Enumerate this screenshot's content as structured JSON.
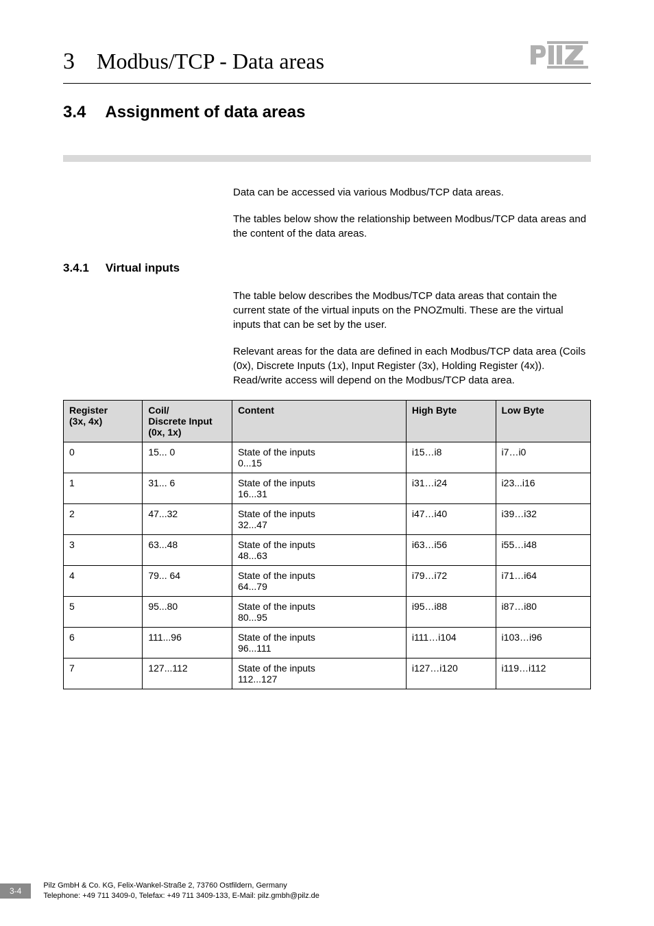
{
  "chapter": {
    "number": "3",
    "title": "Modbus/TCP - Data areas"
  },
  "section": {
    "number": "3.4",
    "title": "Assignment of data areas"
  },
  "intro": {
    "p1": "Data can be accessed via various Modbus/TCP data areas.",
    "p2": "The tables below show the relationship between Modbus/TCP data areas and the content of the data areas."
  },
  "subsection": {
    "number": "3.4.1",
    "title": "Virtual inputs"
  },
  "subintro": {
    "p1": "The table below describes the Modbus/TCP data areas that contain the current state of the virtual inputs on the PNOZmulti. These are the virtual inputs that can be set by the user.",
    "p2": "Relevant areas for the data are defined in each Modbus/TCP data area (Coils (0x), Discrete Inputs (1x), Input Register (3x), Holding Register (4x)). Read/write access will depend on the Modbus/TCP data area."
  },
  "table": {
    "headers": {
      "register": "Register\n(3x, 4x)",
      "coil": "Coil/\nDiscrete Input\n(0x, 1x)",
      "content": "Content",
      "high": "High Byte",
      "low": "Low Byte"
    },
    "rows": [
      {
        "reg": "0",
        "coil": "15... 0",
        "content": "State of the inputs\n0...15",
        "high": "i15…i8",
        "low": "i7…i0"
      },
      {
        "reg": "1",
        "coil": "31... 6",
        "content": "State of the inputs\n16...31",
        "high": "i31…i24",
        "low": "i23...i16"
      },
      {
        "reg": "2",
        "coil": "47...32",
        "content": "State of the inputs\n32...47",
        "high": "i47…i40",
        "low": "i39…i32"
      },
      {
        "reg": "3",
        "coil": "63...48",
        "content": "State of the inputs\n48...63",
        "high": "i63…i56",
        "low": "i55…i48"
      },
      {
        "reg": "4",
        "coil": "79... 64",
        "content": "State of the inputs\n64...79",
        "high": "i79…i72",
        "low": "i71…i64"
      },
      {
        "reg": "5",
        "coil": "95...80",
        "content": "State of the inputs\n80...95",
        "high": "i95…i88",
        "low": "i87…i80"
      },
      {
        "reg": "6",
        "coil": "111...96",
        "content": "State of the inputs\n96...111",
        "high": "i111…i104",
        "low": "i103…i96"
      },
      {
        "reg": "7",
        "coil": "127...112",
        "content": "State of the inputs\n112...127",
        "high": "i127…i120",
        "low": "i119…i112"
      }
    ]
  },
  "footer": {
    "page": "3-4",
    "line1": "Pilz GmbH & Co. KG, Felix-Wankel-Straße 2, 73760 Ostfildern, Germany",
    "line2": "Telephone: +49 711 3409-0, Telefax: +49 711 3409-133, E-Mail: pilz.gmbh@pilz.de"
  }
}
